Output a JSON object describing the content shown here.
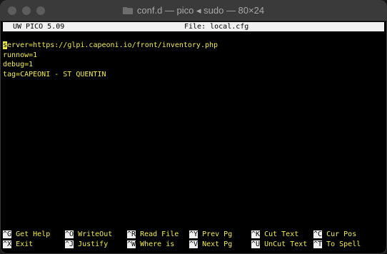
{
  "window": {
    "title": "conf.d — pico ◂ sudo — 80×24"
  },
  "editor": {
    "version": "UW PICO 5.09",
    "file_label": "File: local.cfg",
    "lines": [
      {
        "cursor": "s",
        "rest": "erver=https://glpi.capeoni.io/front/inventory.php"
      },
      {
        "cursor": "",
        "rest": "runnow=1"
      },
      {
        "cursor": "",
        "rest": "debug=1"
      },
      {
        "cursor": "",
        "rest": "tag=CAPEONI - ST QUENTIN"
      }
    ]
  },
  "shortcuts": {
    "row1": [
      {
        "key": "^G",
        "label": "Get Help"
      },
      {
        "key": "^O",
        "label": "WriteOut"
      },
      {
        "key": "^R",
        "label": "Read File"
      },
      {
        "key": "^Y",
        "label": "Prev Pg"
      },
      {
        "key": "^K",
        "label": "Cut Text"
      },
      {
        "key": "^C",
        "label": "Cur Pos"
      }
    ],
    "row2": [
      {
        "key": "^X",
        "label": "Exit"
      },
      {
        "key": "^J",
        "label": "Justify"
      },
      {
        "key": "^W",
        "label": "Where is"
      },
      {
        "key": "^V",
        "label": "Next Pg"
      },
      {
        "key": "^U",
        "label": "UnCut Text"
      },
      {
        "key": "^T",
        "label": "To Spell"
      }
    ]
  }
}
